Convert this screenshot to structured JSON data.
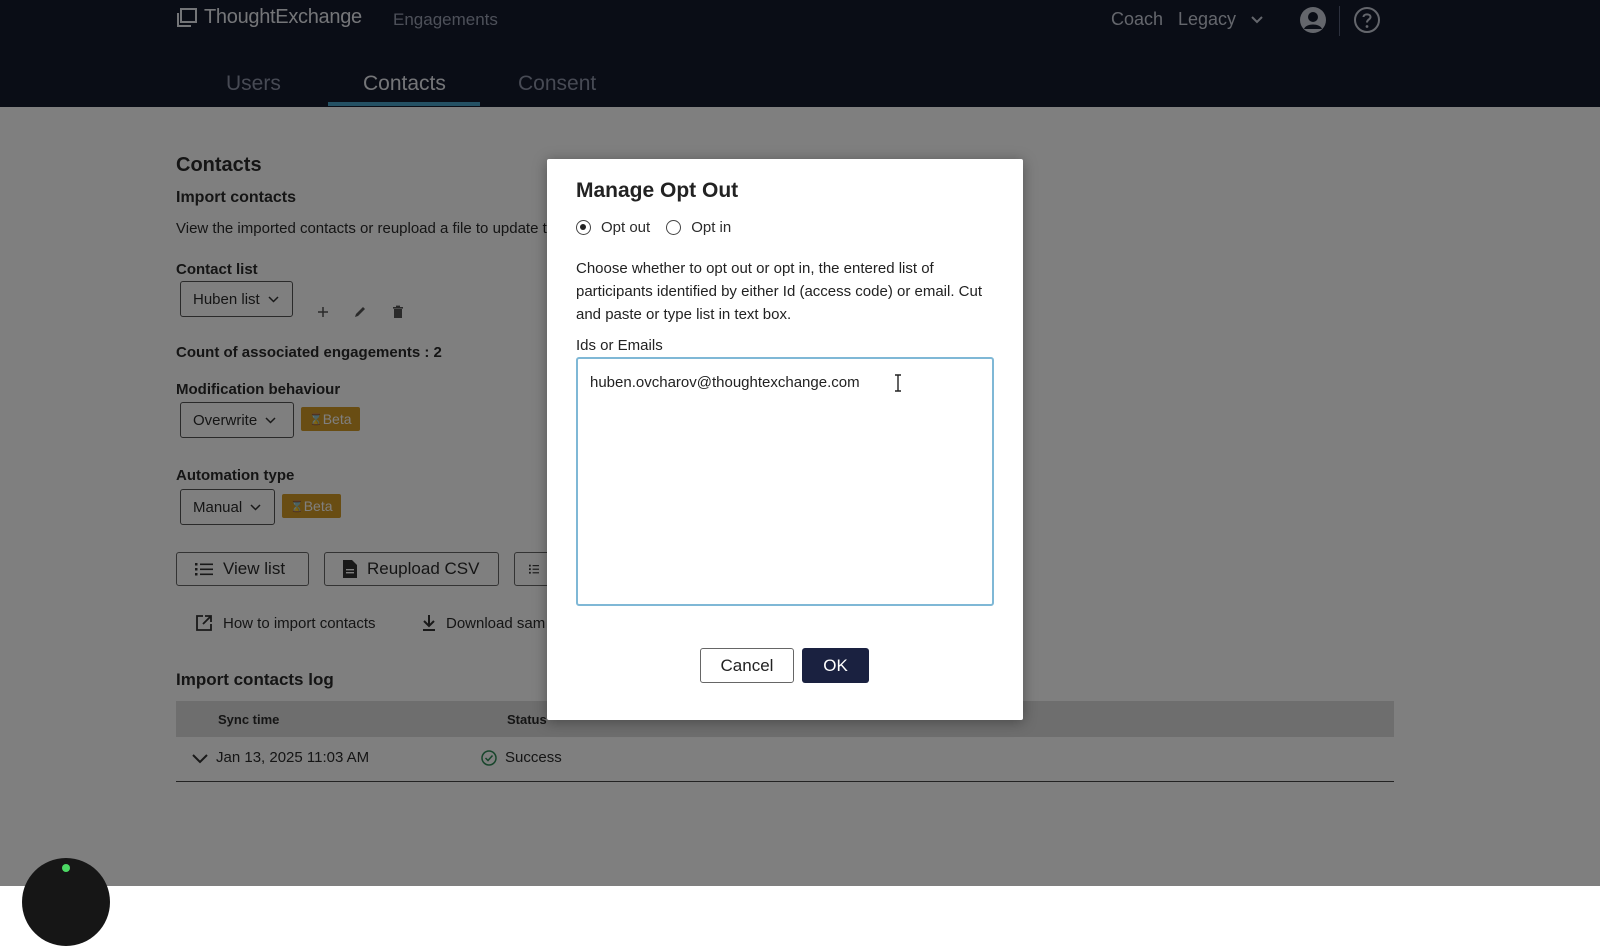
{
  "topbar": {
    "logo_text": "ThoughtExchange",
    "nav_engagements": "Engagements",
    "nav_coach": "Coach",
    "nav_legacy": "Legacy",
    "tabs": [
      {
        "label": "Users"
      },
      {
        "label": "Contacts",
        "active": true
      },
      {
        "label": "Consent"
      }
    ],
    "accent_color": "#4aa3c8"
  },
  "page": {
    "title": "Contacts",
    "import_heading": "Import contacts",
    "import_description": "View the imported contacts or reupload a file to update t",
    "contact_list_label": "Contact list",
    "contact_list_value": "Huben list",
    "count_label": "Count of associated engagements : 2",
    "modification_label": "Modification behaviour",
    "modification_value": "Overwrite",
    "beta_badge": "Beta",
    "automation_label": "Automation type",
    "automation_value": "Manual",
    "buttons": {
      "view_list": "View list",
      "reupload_csv": "Reupload CSV"
    },
    "links": {
      "how_to_import": "How to import contacts",
      "download_sample": "Download sam"
    },
    "log": {
      "title": "Import contacts log",
      "columns": [
        "Sync time",
        "Status"
      ],
      "rows": [
        {
          "sync_time": "Jan 13, 2025 11:03 AM",
          "status": "Success"
        }
      ]
    }
  },
  "modal": {
    "title": "Manage Opt Out",
    "radio_opt_out": "Opt out",
    "radio_opt_in": "Opt in",
    "selected": "Opt out",
    "description": "Choose whether to opt out or opt in, the entered list of participants identified by either Id (access code) or email. Cut and paste or type list in text box.",
    "field_label": "Ids or Emails",
    "field_value": "huben.ovcharov@thoughtexchange.com",
    "cancel_label": "Cancel",
    "ok_label": "OK"
  }
}
